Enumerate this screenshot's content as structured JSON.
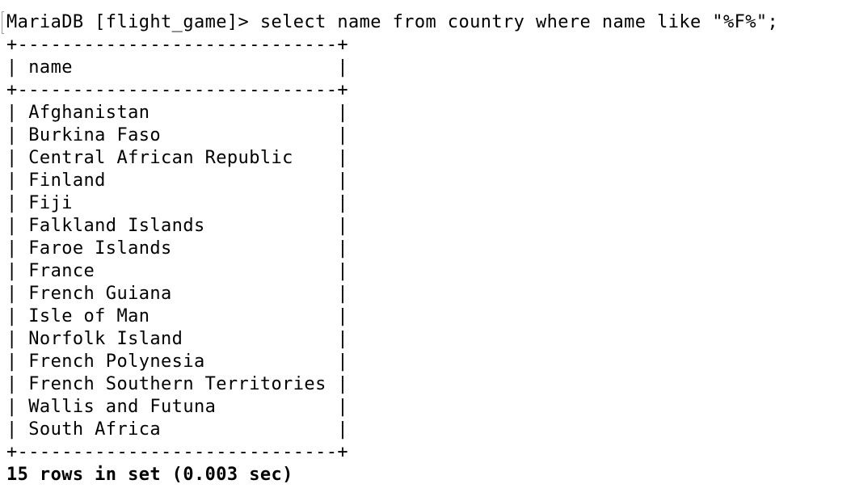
{
  "terminal": {
    "prompt": "MariaDB [flight_game]> ",
    "command": "select name from country where name like \"%F%\";",
    "table": {
      "border": "+-----------------------------+",
      "header": "| name                        |",
      "rows": [
        "| Afghanistan                 |",
        "| Burkina Faso                |",
        "| Central African Republic    |",
        "| Finland                     |",
        "| Fiji                        |",
        "| Falkland Islands            |",
        "| Faroe Islands               |",
        "| France                      |",
        "| French Guiana               |",
        "| Isle of Man                 |",
        "| Norfolk Island              |",
        "| French Polynesia            |",
        "| French Southern Territories |",
        "| Wallis and Futuna           |",
        "| South Africa                |"
      ]
    },
    "summary": "15 rows in set (0.003 sec)"
  }
}
